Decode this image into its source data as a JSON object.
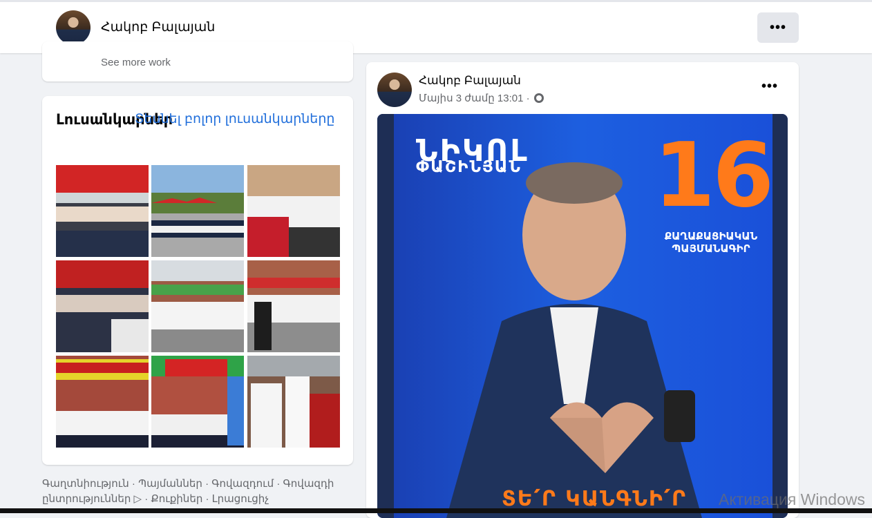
{
  "profile": {
    "name": "Հակոբ Բալայան",
    "more_label": "•••"
  },
  "left_column": {
    "see_more_work": "See more work",
    "photos_title": "Լուսանկարներ",
    "photos_link": "Տեսնել բոլոր լուսանկարները",
    "photos": [
      {
        "alt": "photo-1"
      },
      {
        "alt": "photo-2"
      },
      {
        "alt": "photo-3"
      },
      {
        "alt": "photo-4"
      },
      {
        "alt": "photo-5"
      },
      {
        "alt": "photo-6"
      },
      {
        "alt": "photo-7"
      },
      {
        "alt": "photo-8"
      },
      {
        "alt": "photo-9"
      }
    ],
    "footer_line1": "Գաղտնիություն · Պայմաններ · Գովազդում · Գովազդի",
    "footer_line2": "ընտրություններ ▷ · Քուքիներ · Լրացուցիչ"
  },
  "post": {
    "author": "Հակոբ Բալայան",
    "timestamp": "Մայիս 3 ժամը 13:01 ·",
    "more_label": "•••",
    "poster": {
      "name": "ՆԻԿՈԼ",
      "surname": "ՓԱՇԻՆՅԱՆ",
      "number": "16",
      "party_line1": "ՔԱՂԱՔԱՑԻԱԿԱՆ",
      "party_line2": "ՊԱՅՄԱՆԱԳԻՐ",
      "slogan": "ՏԵ՛Ր ԿԱՆԳՆԻ՛Ր"
    }
  },
  "watermark": "Активация Windows"
}
